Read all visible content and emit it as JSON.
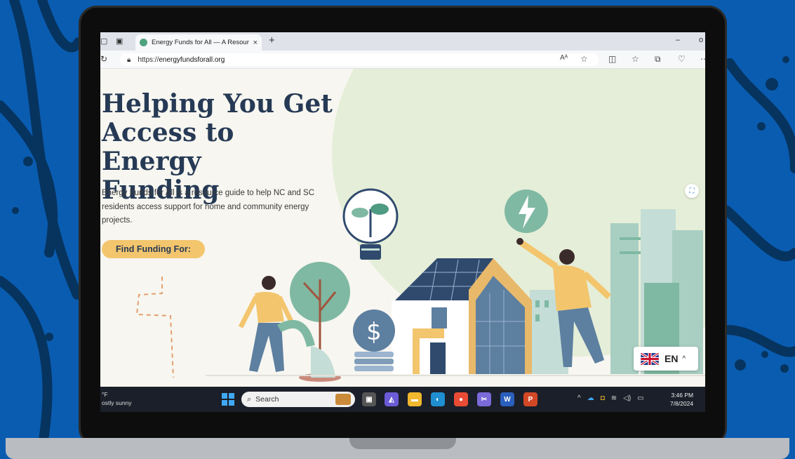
{
  "browser": {
    "tab_title": "Energy Funds for All — A Resour",
    "tab_close": "×",
    "new_tab": "+",
    "minimize": "–",
    "restore": "o",
    "url_prefix": "https://",
    "url_domain": "energyfundsforall.org",
    "read_aloud": "Aᴬ",
    "favorite": "☆"
  },
  "hero": {
    "headline_line1": "Helping You Get",
    "headline_line2": "Access to Energy",
    "headline_line3": "Funding",
    "subtitle": "Energy Funds for All is a resource guide to help NC and SC residents access support for home and community energy projects.",
    "cta_label": "Find Funding For:"
  },
  "language": {
    "code": "EN",
    "caret": "^"
  },
  "taskbar": {
    "weather_temp": "°F",
    "weather_desc": "ostly sunny",
    "search_label": "Search",
    "tray_caret": "^",
    "time": "3:46 PM",
    "date": "7/8/2024"
  },
  "colors": {
    "headline": "#263a55",
    "cta": "#f3c56d",
    "accent_green": "#7fb9a3",
    "hero_bg": "#e5eed8",
    "laptop_bg": "#0a5cb0"
  }
}
